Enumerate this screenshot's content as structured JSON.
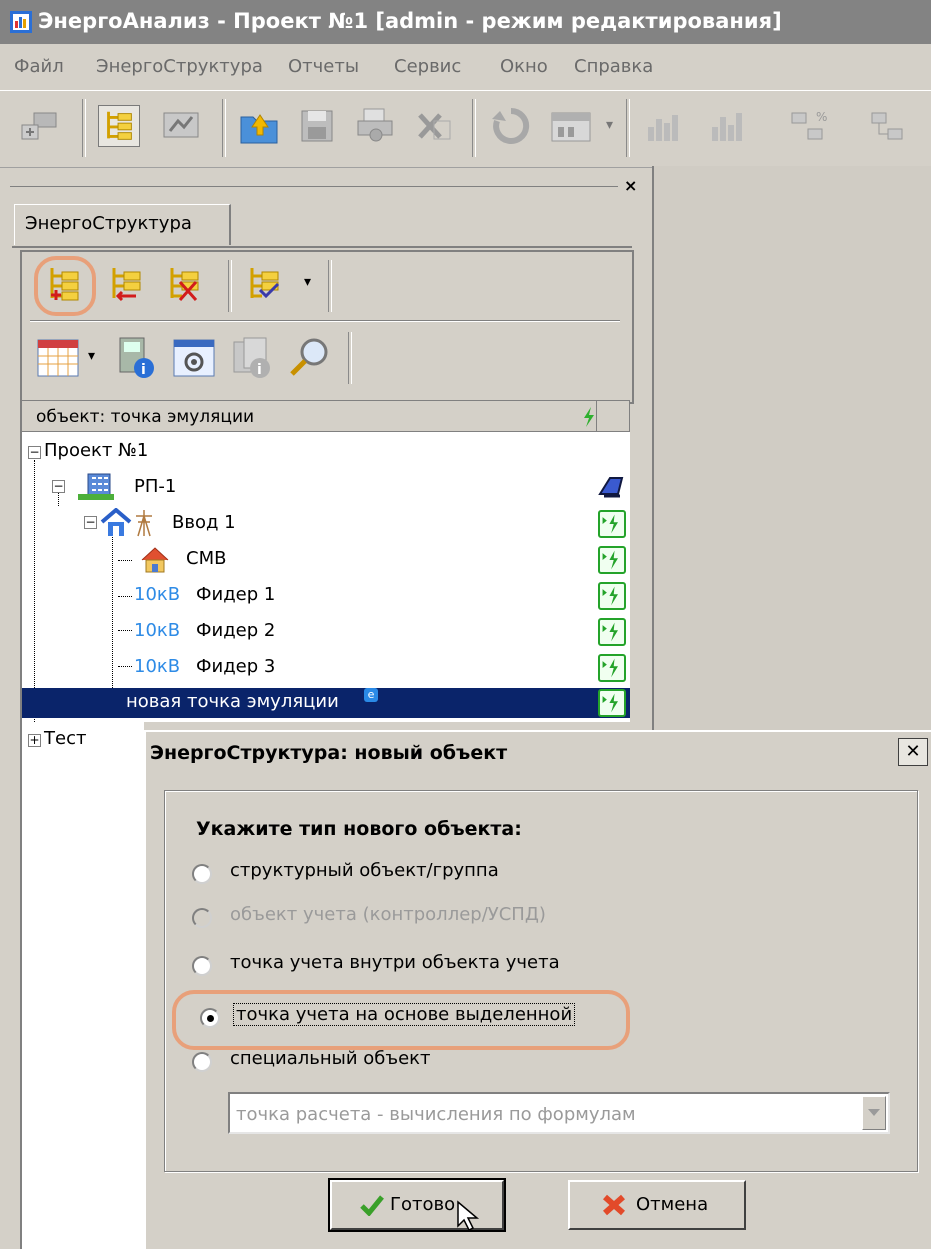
{
  "window": {
    "title": "ЭнергоАнализ - Проект №1 [admin - режим редактирования]"
  },
  "menu": [
    "Файл",
    "ЭнергоСтруктура",
    "Отчеты",
    "Сервис",
    "Окно",
    "Справка"
  ],
  "panel": {
    "tab_label": "ЭнергоСтруктура",
    "close_glyph": "×",
    "tree_header": "объект: точка эмуляции"
  },
  "tree": {
    "project": "Проект №1",
    "rp": "РП-1",
    "input": "Ввод 1",
    "smv": "СМВ",
    "feeders": [
      {
        "voltage": "10кВ",
        "name": "Фидер 1"
      },
      {
        "voltage": "10кВ",
        "name": "Фидер 2"
      },
      {
        "voltage": "10кВ",
        "name": "Фидер 3"
      }
    ],
    "new_point": "новая точка эмуляции",
    "new_point_badge": "e",
    "test": "Тест"
  },
  "dialog": {
    "title": "ЭнергоСтруктура: новый объект",
    "close_glyph": "✕",
    "prompt": "Укажите тип нового объекта:",
    "options": [
      {
        "label": "структурный объект/группа",
        "selected": false,
        "enabled": true
      },
      {
        "label": "объект учета (контроллер/УСПД)",
        "selected": false,
        "enabled": false
      },
      {
        "label": "точка учета внутри объекта учета",
        "selected": false,
        "enabled": true
      },
      {
        "label": "точка учета на основе выделенной",
        "selected": true,
        "enabled": true
      },
      {
        "label": "специальный объект",
        "selected": false,
        "enabled": true
      }
    ],
    "special_select": "точка расчета - вычисления по формулам",
    "ok_label": "Готово",
    "cancel_label": "Отмена"
  },
  "colors": {
    "selection": "#0a246a",
    "voltage": "#2e8be6",
    "highlight": "#e8a07a",
    "badge_green": "#24a32a"
  }
}
